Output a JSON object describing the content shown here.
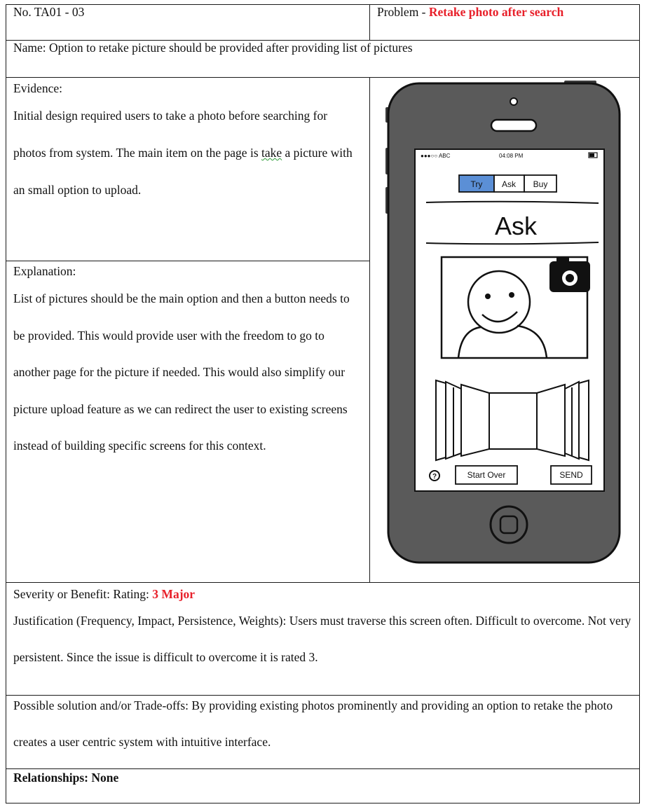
{
  "header": {
    "number": "No. TA01 - 03",
    "problem_label": "Problem - ",
    "problem_title": "Retake photo after search"
  },
  "name": "Name: Option to retake picture should be provided after providing list of pictures",
  "evidence": {
    "heading": "Evidence:",
    "text_before": "Initial design required users to take a photo before searching for photos from system. The main item on the page is ",
    "text_misspelled": "take",
    "text_after": " a picture with an small option to upload."
  },
  "explanation": {
    "heading": "Explanation:",
    "text": "List of pictures should be the main option and then a button needs to be provided. This would provide user with the freedom to go to another page for the picture if needed. This would also simplify our picture upload feature as we can redirect the user to existing screens instead of building specific screens for this context."
  },
  "mockup": {
    "status_carrier": "●●●○○ ABC",
    "status_time": "04:08 PM",
    "tabs": [
      "Try",
      "Ask",
      "Buy"
    ],
    "title": "Ask",
    "help_glyph": "?",
    "start_over_label": "Start Over",
    "send_label": "SEND"
  },
  "severity": {
    "label": "Severity or Benefit: Rating: ",
    "rating": "3 Major",
    "justification": "Justification (Frequency, Impact, Persistence, Weights): Users must traverse this screen often. Difficult to overcome. Not very persistent. Since the issue is difficult to overcome it is rated 3."
  },
  "solution": "Possible solution and/or Trade-offs: By providing existing photos prominently and providing an option to retake the photo creates a user centric system with intuitive interface.",
  "relationships": "Relationships: None",
  "colors": {
    "accent_red": "#e8202a",
    "phone_body": "#5a5a5a",
    "tab_selected": "#5b8fd6"
  }
}
